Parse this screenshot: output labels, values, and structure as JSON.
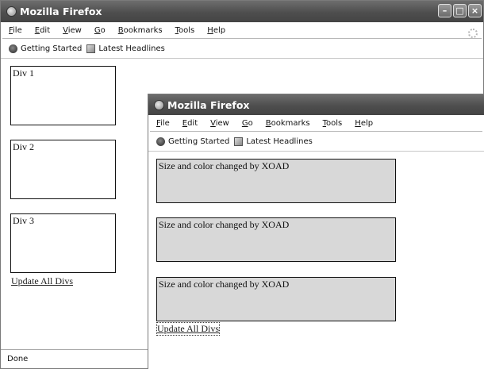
{
  "back_window": {
    "title": "Mozilla Firefox",
    "menu": [
      "File",
      "Edit",
      "View",
      "Go",
      "Bookmarks",
      "Tools",
      "Help"
    ],
    "bookmarks": [
      "Getting Started",
      "Latest Headlines"
    ],
    "divs": [
      "Div 1",
      "Div 2",
      "Div 3"
    ],
    "update_link": "Update All Divs",
    "status": "Done"
  },
  "front_window": {
    "title": "Mozilla Firefox",
    "menu": [
      "File",
      "Edit",
      "View",
      "Go",
      "Bookmarks",
      "Tools",
      "Help"
    ],
    "bookmarks": [
      "Getting Started",
      "Latest Headlines"
    ],
    "divs": [
      "Size and color changed by XOAD",
      "Size and color changed by XOAD",
      "Size and color changed by XOAD"
    ],
    "update_link": "Update All Divs"
  },
  "colors": {
    "titlebar": "#4e4e4e",
    "changed_div_bg": "#d8d8d8"
  }
}
